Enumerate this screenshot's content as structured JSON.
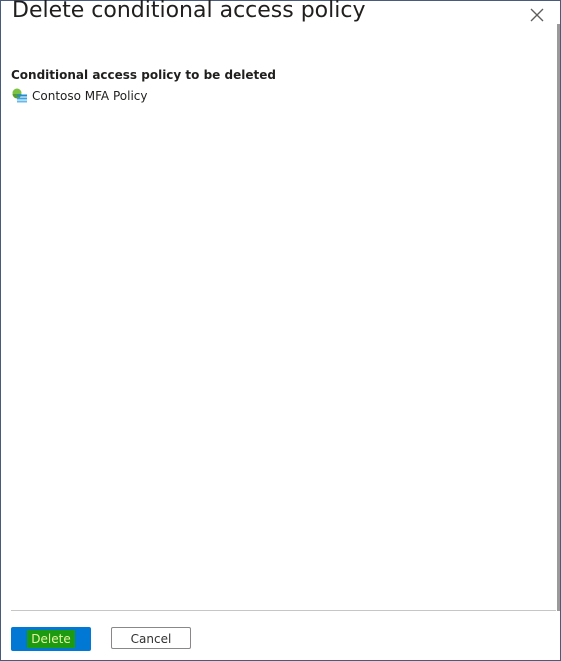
{
  "dialog": {
    "title": "Delete conditional access policy",
    "close_icon": "close-icon"
  },
  "content": {
    "section_label": "Conditional access policy to be deleted",
    "policy": {
      "icon": "conditional-access-policy-icon",
      "name": "Contoso MFA Policy"
    }
  },
  "footer": {
    "delete_label": "Delete",
    "cancel_label": "Cancel"
  },
  "colors": {
    "primary_button": "#0078d4",
    "highlight": "#1c9a12",
    "border": "#4a5a7a"
  }
}
